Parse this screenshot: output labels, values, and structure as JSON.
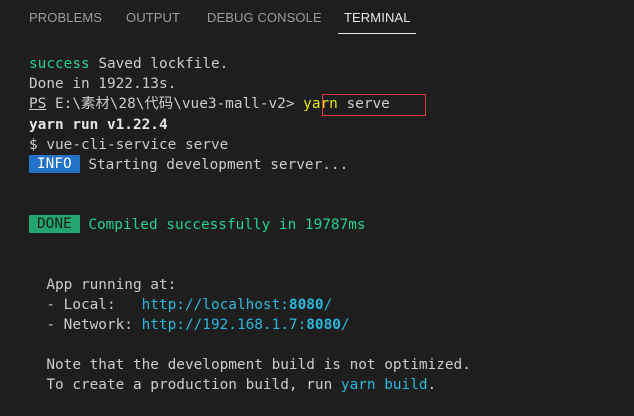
{
  "tabs": [
    {
      "label": "PROBLEMS"
    },
    {
      "label": "OUTPUT"
    },
    {
      "label": "DEBUG CONSOLE"
    },
    {
      "label": "TERMINAL",
      "active": true
    }
  ],
  "terminal": {
    "l1": {
      "status": "success",
      "text": " Saved lockfile."
    },
    "l2": {
      "text": "Done in 1922.13s."
    },
    "l3": {
      "ps": "PS",
      "path": " E:\\素材\\28\\代码\\vue3-mall-v2> ",
      "cmd": "yarn",
      "arg": " serve"
    },
    "l4": {
      "text": "yarn run v1.22.4"
    },
    "l5": {
      "text": "$ vue-cli-service serve"
    },
    "l6": {
      "badge": "INFO",
      "text": " Starting development server..."
    },
    "l7": {
      "badge": "DONE",
      "text": " Compiled successfully in 19787ms"
    },
    "l8": {
      "text": "  App running at:"
    },
    "l9": {
      "prefix": "  - Local:   ",
      "url": "http://localhost:",
      "port": "8080",
      "tail": "/"
    },
    "l10": {
      "prefix": "  - Network: ",
      "url": "http://192.168.1.7:",
      "port": "8080",
      "tail": "/"
    },
    "l11": {
      "text": "  Note that the development build is not optimized."
    },
    "l12": {
      "prefix": "  To create a production build, run ",
      "cmd": "yarn build",
      "tail": "."
    }
  },
  "colors": {
    "background": "#1e1e1e",
    "success": "#23d18b",
    "link": "#29b8db",
    "info_badge": "#2472c8",
    "done_badge": "#23a66d",
    "highlight_box": "#e0383e"
  }
}
